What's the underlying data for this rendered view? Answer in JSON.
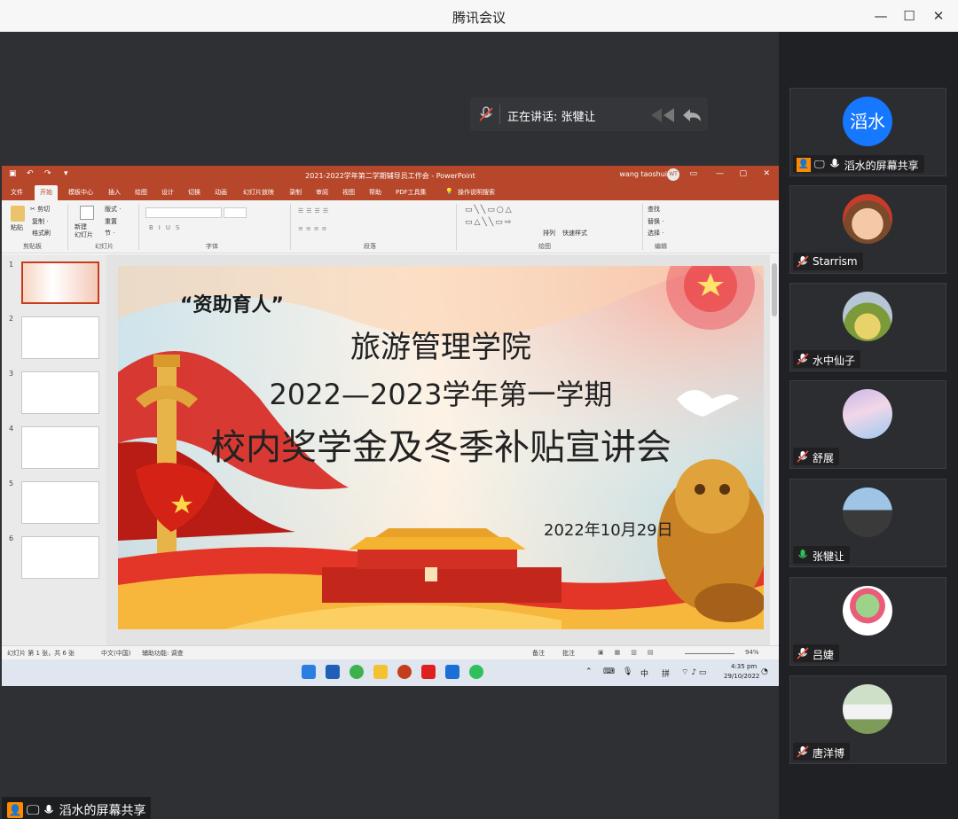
{
  "window": {
    "title": "腾讯会议",
    "minimize": "—",
    "maximize": "☐",
    "close": "✕"
  },
  "speaker_banner": {
    "text": "正在讲话: 张犍让"
  },
  "ppt": {
    "doc_title": "2021-2022学年第二学期辅导员工作会 - PowerPoint",
    "user": "wang taoshui",
    "user_initials": "WT",
    "tabs": [
      "文件",
      "开始",
      "模板中心",
      "插入",
      "绘图",
      "设计",
      "切换",
      "动画",
      "幻灯片放映",
      "录制",
      "审阅",
      "视图",
      "帮助",
      "PDF工具集",
      "操作说明搜索"
    ],
    "active_tab": "开始",
    "ribbon": {
      "paste": "粘贴",
      "cut": "✂ 剪切",
      "copy": "复制 ·",
      "format_painter": "格式刷",
      "new_slide": "新建\n幻灯片",
      "layout": "版式 ·",
      "reset": "重置",
      "section": "节 ·",
      "find": "查找",
      "replace": "替换 ·",
      "select": "选择 ·",
      "arrange": "排列",
      "quick_styles": "快速样式",
      "groups": [
        "剪贴板",
        "幻灯片",
        "字体",
        "段落",
        "绘图",
        "编辑"
      ]
    },
    "thumb_numbers": [
      "1",
      "2",
      "3",
      "4",
      "5",
      "6"
    ],
    "slide": {
      "slogan": "“资助育人”",
      "line1": "旅游管理学院",
      "line2": "2022—2023学年第一学期",
      "line3": "校内奖学金及冬季补贴宣讲会",
      "date": "2022年10月29日"
    },
    "status": {
      "slide_info": "幻灯片 第 1 张，共 6 张",
      "language": "中文(中国)",
      "accessibility": "辅助功能: 调查",
      "notes": "备注",
      "comments": "批注",
      "zoom": "94%"
    }
  },
  "taskbar": {
    "tray_lang": "中",
    "tray_ime": "拼",
    "time": "4:35 pm",
    "date": "29/10/2022"
  },
  "bottom_label": "滔水的屏幕共享",
  "participants": [
    {
      "name": "滔水的屏幕共享",
      "avatar_text": "滔水",
      "avatar_kind": "text",
      "mic": "on",
      "sharing": true
    },
    {
      "name": "Starrism",
      "avatar_kind": "cartoon",
      "mic": "muted"
    },
    {
      "name": "水中仙子",
      "avatar_kind": "plant",
      "mic": "muted"
    },
    {
      "name": "舒展",
      "avatar_kind": "sky",
      "mic": "muted"
    },
    {
      "name": "张犍让",
      "avatar_kind": "person",
      "mic": "on"
    },
    {
      "name": "吕婕",
      "avatar_kind": "tree",
      "mic": "muted"
    },
    {
      "name": "唐洋博",
      "avatar_kind": "couple",
      "mic": "muted"
    }
  ],
  "colors": {
    "ppt_red": "#b7472a",
    "meeting_bg": "#2b2d30",
    "sidebar_bg": "#202124",
    "mic_on": "#2fc05a",
    "avatar_blue": "#1677ff",
    "share_orange": "#ff8a00"
  }
}
